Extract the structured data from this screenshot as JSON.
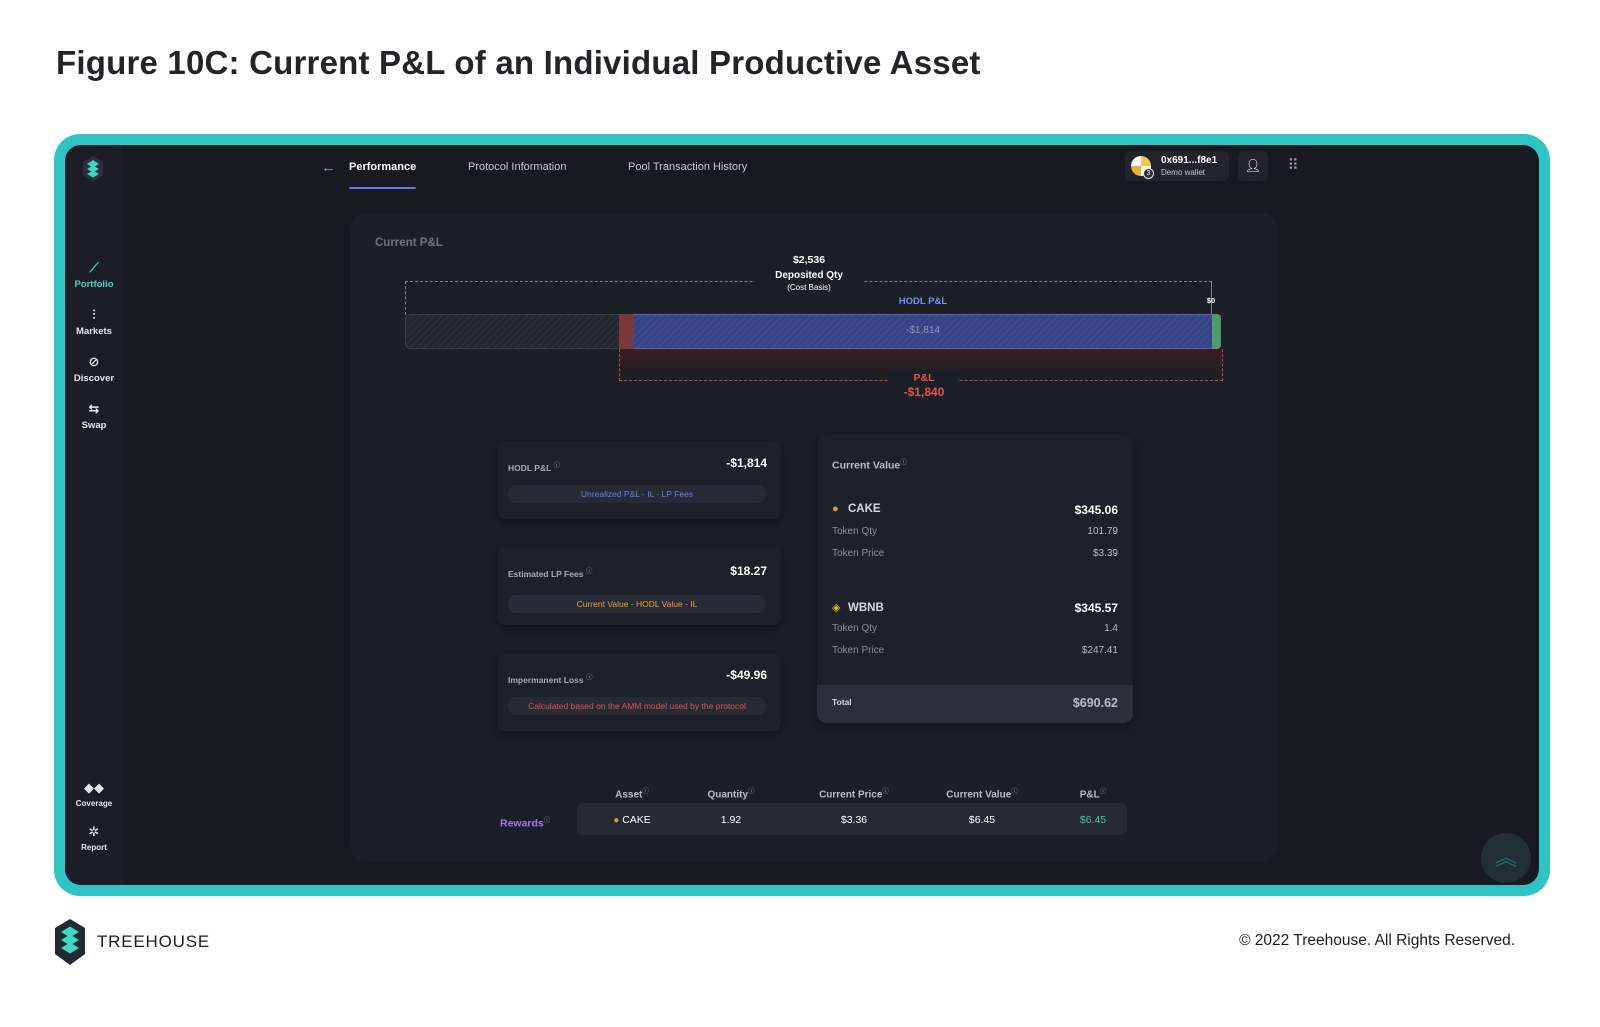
{
  "figure_title": "Figure 10C: Current P&L of an Individual Productive Asset",
  "sidebar": {
    "items": [
      {
        "label": "Portfolio",
        "icon": "trend-icon"
      },
      {
        "label": "Markets",
        "icon": "candlestick-icon"
      },
      {
        "label": "Discover",
        "icon": "compass-icon"
      },
      {
        "label": "Swap",
        "icon": "swap-icon"
      },
      {
        "label": "Coverage",
        "icon": "coverage-icon"
      },
      {
        "label": "Report",
        "icon": "bug-icon"
      }
    ],
    "active": "Portfolio"
  },
  "header": {
    "tabs": [
      "Performance",
      "Protocol Information",
      "Pool Transaction History"
    ],
    "active_tab": "Performance",
    "wallet": {
      "address": "0x691...f8e1",
      "label": "Demo wallet",
      "badge": "3"
    }
  },
  "card_title": "Current P&L",
  "diagram": {
    "deposit_value": "$2,536",
    "deposit_label": "Deposited Qty",
    "deposit_sublabel": "(Cost Basis)",
    "hodl_label": "HODL P&L",
    "hodl_value": "-$1,814",
    "zero_label": "$0",
    "pnl_label": "P&L",
    "pnl_value": "-$1,840"
  },
  "metrics": [
    {
      "label": "HODL P&L",
      "value": "-$1,814",
      "pill": "Unrealized P&L - IL - LP Fees",
      "pill_color": "#6f7fe0"
    },
    {
      "label": "Estimated LP Fees",
      "value": "$18.27",
      "pill": "Current Value - HODL Value - IL",
      "pill_color": "#e8a329"
    },
    {
      "label": "Impermanent Loss",
      "value": "-$49.96",
      "pill": "Calculated based on the AMM model used by the protocol",
      "pill_color": "#e0524c"
    }
  ],
  "current_value": {
    "title": "Current Value",
    "tokens": [
      {
        "name": "CAKE",
        "value": "$345.06",
        "qty_label": "Token Qty",
        "qty": "101.79",
        "price_label": "Token Price",
        "price": "$3.39"
      },
      {
        "name": "WBNB",
        "value": "$345.57",
        "qty_label": "Token Qty",
        "qty": "1.4",
        "price_label": "Token Price",
        "price": "$247.41"
      }
    ],
    "total_label": "Total",
    "total_value": "$690.62"
  },
  "rewards": {
    "row_label": "Rewards",
    "columns": [
      "Asset",
      "Quantity",
      "Current Price",
      "Current Value",
      "P&L"
    ],
    "row": {
      "asset": "CAKE",
      "quantity": "1.92",
      "price": "$3.36",
      "value": "$6.45",
      "pnl": "$6.45"
    }
  },
  "footer": {
    "brand": "TREEHOUSE",
    "copyright": "© 2022 Treehouse. All Rights Reserved."
  },
  "colors": {
    "frame": "#2ec4c4",
    "accent": "#3fd5c5",
    "negative": "#e8554f",
    "positive": "#41c49a"
  }
}
